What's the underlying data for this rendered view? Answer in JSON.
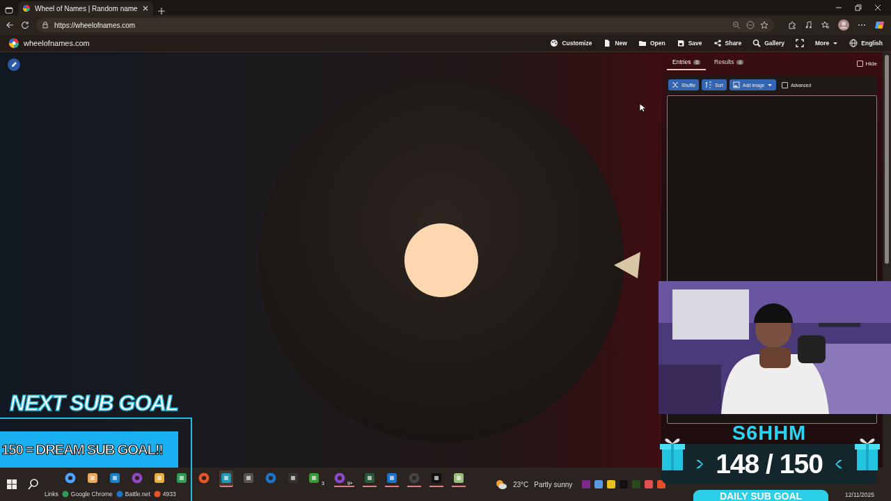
{
  "browser": {
    "tab_title": "Wheel of Names | Random name",
    "url": "https://wheelofnames.com"
  },
  "site": {
    "logo_text": "wheelofnames.com",
    "menu": [
      {
        "kind": "link",
        "label": "Customize"
      },
      {
        "kind": "link",
        "label": "New"
      },
      {
        "kind": "link",
        "label": "Open"
      },
      {
        "kind": "link",
        "label": "Save"
      },
      {
        "kind": "link",
        "label": "Share"
      },
      {
        "kind": "link",
        "label": "Gallery"
      },
      {
        "kind": "icon"
      },
      {
        "kind": "dropdown",
        "label": "More"
      },
      {
        "kind": "link",
        "label": "English"
      }
    ]
  },
  "panel": {
    "tabs": [
      {
        "label": "Entries",
        "count": "0",
        "selected": true
      },
      {
        "label": "Results",
        "count": "4",
        "selected": false
      }
    ],
    "hide": {
      "label": "Hide",
      "checked": false
    },
    "buttons": [
      {
        "label": "Shuffle",
        "kind": "button"
      },
      {
        "label": "Sort",
        "kind": "button"
      },
      {
        "label": "Add image",
        "kind": "dropdown"
      }
    ],
    "advanced": {
      "label": "Advanced",
      "checked": false
    }
  },
  "overlay": {
    "next_goal_title": "NEXT SUB GOAL",
    "next_goal_text": "150 = DREAM SUB GOAL!!",
    "goal_widget": {
      "name": "S6HHM",
      "count": "148 / 150",
      "label": "DAILY SUB GOAL"
    }
  },
  "taskbar": {
    "apps": [
      {
        "running": false,
        "selected": false
      },
      {
        "running": false,
        "selected": false
      },
      {
        "running": false,
        "selected": false
      },
      {
        "running": false,
        "selected": false
      },
      {
        "running": false,
        "selected": false
      },
      {
        "running": false,
        "selected": false
      },
      {
        "running": false,
        "selected": false
      },
      {
        "running": true,
        "selected": true
      },
      {
        "running": false,
        "selected": false
      },
      {
        "running": false,
        "selected": false
      },
      {
        "running": false,
        "selected": false
      },
      {
        "running": false,
        "selected": false,
        "badge": "3"
      },
      {
        "running": true,
        "selected": false,
        "badge": "9+"
      },
      {
        "running": true,
        "selected": false
      },
      {
        "running": true,
        "selected": false
      },
      {
        "running": true,
        "selected": false
      },
      {
        "running": true,
        "selected": false
      },
      {
        "running": true,
        "selected": false
      }
    ],
    "links_label": "Links",
    "links": [
      "Google Chrome",
      "Battle.net",
      "4933"
    ],
    "weather": {
      "temperature": "23°C",
      "condition": "Partly sunny"
    },
    "date": "12/11/2025"
  }
}
